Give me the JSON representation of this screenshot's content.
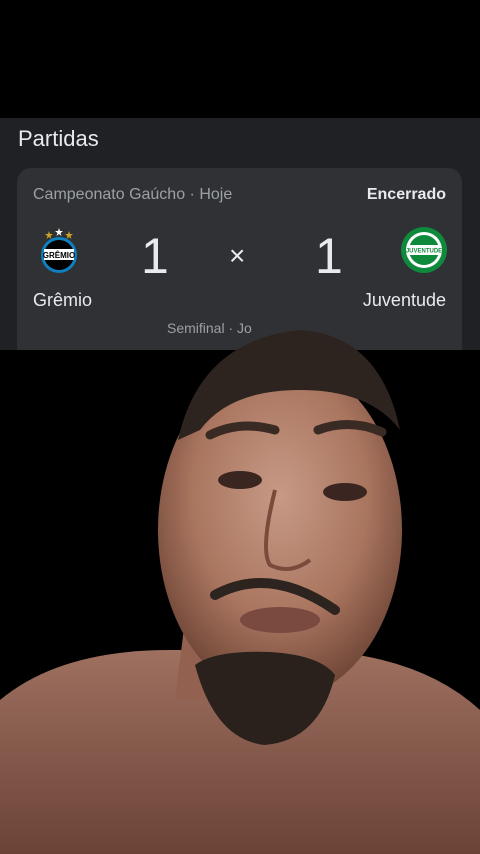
{
  "panel": {
    "title": "Partidas"
  },
  "match": {
    "league": "Campeonato Gaúcho · Hoje",
    "status": "Encerrado",
    "home": {
      "name": "Grêmio",
      "score": "1",
      "logo_text": "GRÊMIO"
    },
    "away": {
      "name": "Juventude",
      "score": "1",
      "logo_text": "JUVENTUDE"
    },
    "separator": "×",
    "stage": "Semifinal · Jo"
  },
  "colors": {
    "panel_bg": "#202124",
    "card_bg": "#303134",
    "gremio_blue": "#0d80bf",
    "juventude_green": "#0f8a3c"
  }
}
